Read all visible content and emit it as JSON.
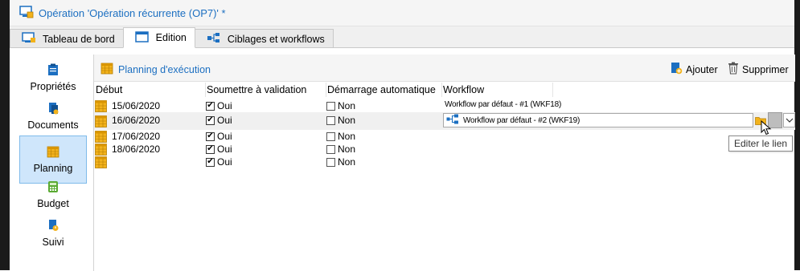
{
  "window": {
    "title": "Opération 'Opération récurrente (OP7)' *"
  },
  "tabs": [
    {
      "label": "Tableau de bord",
      "icon": "dashboard-icon",
      "active": false
    },
    {
      "label": "Edition",
      "icon": "edit-window-icon",
      "active": true
    },
    {
      "label": "Ciblages et workflows",
      "icon": "workflow-icon",
      "active": false
    }
  ],
  "sidebar": {
    "items": [
      {
        "label": "Propriétés",
        "icon": "clipboard-icon"
      },
      {
        "label": "Documents",
        "icon": "documents-icon"
      },
      {
        "label": "Planning",
        "icon": "calendar-icon",
        "active": true
      },
      {
        "label": "Budget",
        "icon": "budget-icon"
      },
      {
        "label": "Suivi",
        "icon": "tracking-icon"
      }
    ]
  },
  "panel": {
    "title": "Planning d'exécution",
    "add_label": "Ajouter",
    "delete_label": "Supprimer"
  },
  "grid": {
    "columns": [
      "Début",
      "Soumettre à validation",
      "Démarrage automatique",
      "Workflow"
    ],
    "rows": [
      {
        "date": "15/06/2020",
        "validation": "Oui",
        "validation_checked": true,
        "auto": "Non",
        "auto_checked": false,
        "workflow": "Workflow par défaut - #1 (WKF18)"
      },
      {
        "date": "16/06/2020",
        "validation": "Oui",
        "validation_checked": true,
        "auto": "Non",
        "auto_checked": false,
        "workflow": "Workflow par défaut - #2 (WKF19)",
        "selected": true
      },
      {
        "date": "17/06/2020",
        "validation": "Oui",
        "validation_checked": true,
        "auto": "Non",
        "auto_checked": false,
        "workflow": ""
      },
      {
        "date": "18/06/2020",
        "validation": "Oui",
        "validation_checked": true,
        "auto": "Non",
        "auto_checked": false,
        "workflow": ""
      },
      {
        "date": "",
        "validation": "Oui",
        "validation_checked": true,
        "auto": "Non",
        "auto_checked": false,
        "workflow": ""
      }
    ]
  },
  "tooltip": {
    "text": "Editer le lien"
  },
  "colors": {
    "accent": "#1c6fc1",
    "selection": "#cfe6fb",
    "calendar": "#f2b21b"
  }
}
